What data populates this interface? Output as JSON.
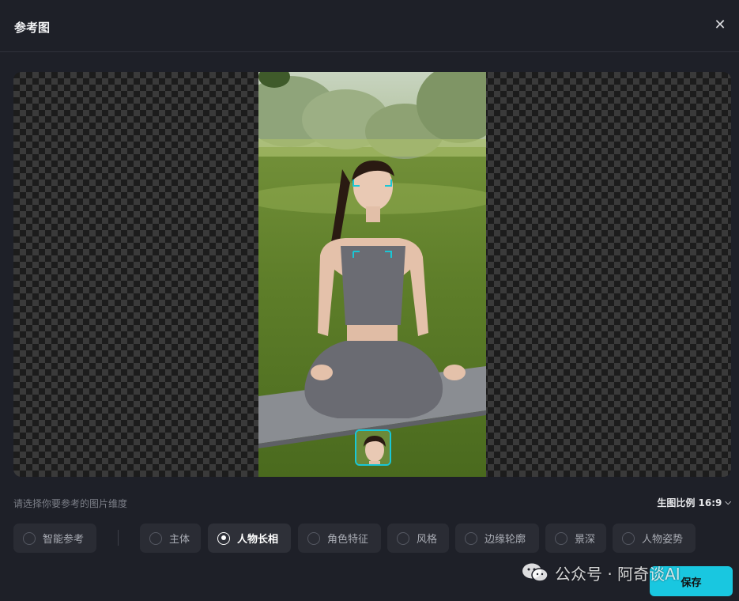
{
  "dialog": {
    "title": "参考图",
    "close_icon": "close-icon"
  },
  "hint": "请选择你要参考的图片维度",
  "ratio": {
    "label": "生图比例 16:9",
    "icon": "chevron-down-icon"
  },
  "options": [
    {
      "label": "智能参考",
      "selected": false
    },
    {
      "label": "主体",
      "selected": false
    },
    {
      "label": "人物长相",
      "selected": true
    },
    {
      "label": "角色特征",
      "selected": false
    },
    {
      "label": "风格",
      "selected": false
    },
    {
      "label": "边缘轮廓",
      "selected": false
    },
    {
      "label": "景深",
      "selected": false
    },
    {
      "label": "人物姿势",
      "selected": false
    }
  ],
  "save_label": "保存",
  "watermark": "公众号 · 阿奇谈AI",
  "colors": {
    "background": "#1e2028",
    "accent": "#19c7e0",
    "chip": "#2a2c34",
    "face_box": "#19c7d6"
  }
}
